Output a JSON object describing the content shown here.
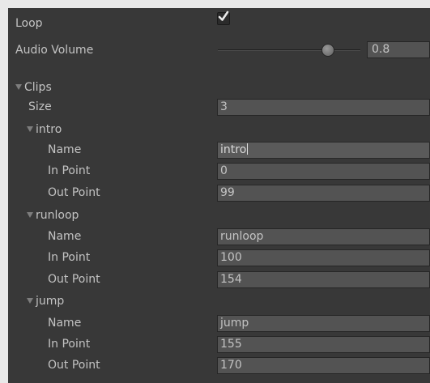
{
  "loop": {
    "label": "Loop",
    "checked": true
  },
  "audio_volume": {
    "label": "Audio Volume",
    "value": "0.8",
    "fraction": 0.8
  },
  "clips": {
    "label": "Clips",
    "size_label": "Size",
    "size_value": "3",
    "items": [
      {
        "header": "intro",
        "name_label": "Name",
        "name": "intro",
        "in_label": "In Point",
        "in_point": "0",
        "out_label": "Out Point",
        "out_point": "99"
      },
      {
        "header": "runloop",
        "name_label": "Name",
        "name": "runloop",
        "in_label": "In Point",
        "in_point": "100",
        "out_label": "Out Point",
        "out_point": "154"
      },
      {
        "header": "jump",
        "name_label": "Name",
        "name": "jump",
        "in_label": "In Point",
        "in_point": "155",
        "out_label": "Out Point",
        "out_point": "170"
      }
    ]
  },
  "icons": {
    "foldout": "triangle-down-icon",
    "check": "checkmark-icon"
  }
}
